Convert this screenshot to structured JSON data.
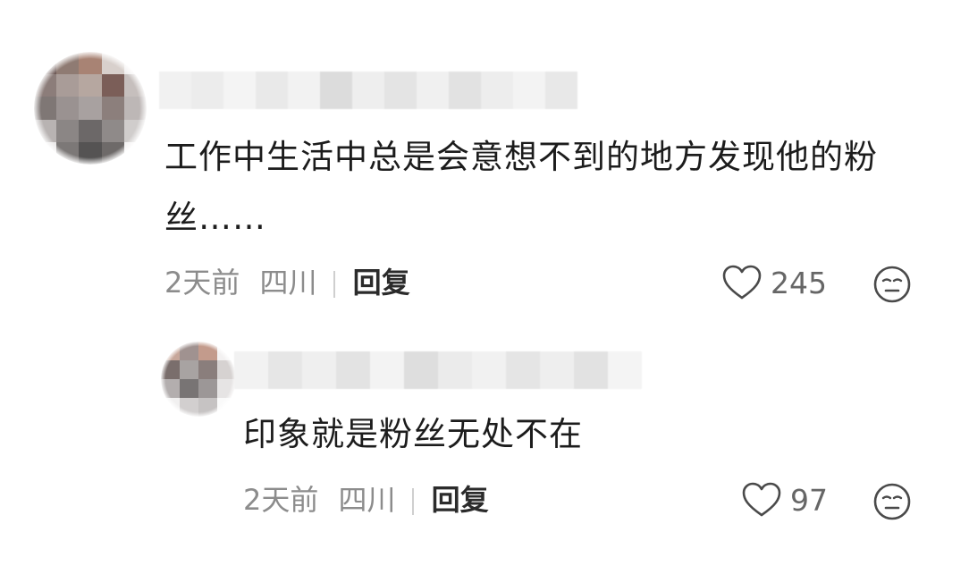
{
  "comment": {
    "avatar_pixels": [
      "#6e5a57",
      "#8f7b73",
      "#a88374",
      "#d8d0cc",
      "#f0eeee",
      "#8c7d7a",
      "#a99c98",
      "#b6a7a0",
      "#7b5e58",
      "#c6bfbd",
      "#7f7775",
      "#9a9291",
      "#a8a1a0",
      "#8c7f7c",
      "#bdb7b6",
      "#b8b3b2",
      "#8b8685",
      "#6c6868",
      "#8f8a89",
      "#d0cdcc",
      "#e9e7e7",
      "#7c7877",
      "#555353",
      "#6e6a69",
      "#f3f2f2"
    ],
    "username_mosaic": [
      "#f1f1f1",
      "#ececec",
      "#f4f4f4",
      "#e9e9e9",
      "#f2f2f2",
      "#dcdcdc",
      "#eeeeee",
      "#e4e4e4",
      "#f0f0f0",
      "#e2e2e2",
      "#ededed",
      "#f3f3f3",
      "#e8e8e8"
    ],
    "text": "工作中生活中总是会意想不到的地方发现他的粉丝……",
    "time": "2天前",
    "location": "四川",
    "reply_label": "回复",
    "likes": "245"
  },
  "reply": {
    "avatar_pixels": [
      "#c7a79a",
      "#a09290",
      "#c39b8c",
      "#f3f1f1",
      "#7a6e6c",
      "#a8a3a2",
      "#8a7e7c",
      "#d6d2d1",
      "#b3aeae",
      "#787474",
      "#9c9797",
      "#e6e4e4",
      "#f1f0f0",
      "#d2cfcf",
      "#c6c3c3",
      "#fafafa"
    ],
    "username_mosaic": [
      "#f2f2f2",
      "#e6e6e6",
      "#efefef",
      "#e3e3e3",
      "#f3f3f3",
      "#dedede",
      "#ebebeb",
      "#f1f1f1",
      "#e5e5e5",
      "#eeeeee",
      "#e2e2e2",
      "#f4f4f4"
    ],
    "text": "印象就是粉丝无处不在",
    "time": "2天前",
    "location": "四川",
    "reply_label": "回复",
    "likes": "97"
  },
  "icons": {
    "like": "heart-outline-icon",
    "emoji": "neutral-face-icon"
  }
}
